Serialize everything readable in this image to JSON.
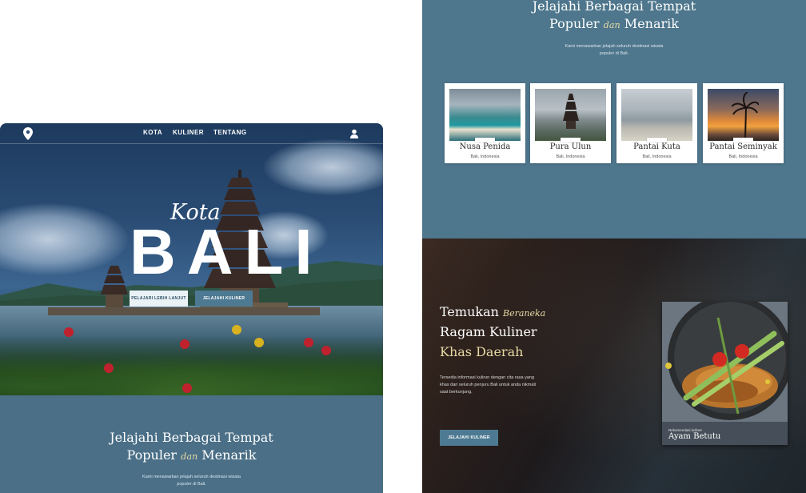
{
  "left_mock": {
    "nav": {
      "items": [
        "KOTA",
        "KULINER",
        "TENTANG"
      ],
      "logo_icon": "map-pin-icon",
      "user_icon": "user-icon"
    },
    "hero": {
      "script_word": "Kota",
      "title": "BALI",
      "primary_button": "PELAJARI LEBIH LANJUT",
      "secondary_button": "JELAJAHI KULINER"
    },
    "section": {
      "title_line1": "Jelajahi Berbagai Tempat",
      "title_line2_start": "Populer",
      "title_line2_accent": "dan",
      "title_line2_end": "Menarik",
      "subtitle_line1": "Kami menawarkan jelajah seluruh destinasi wisata",
      "subtitle_line2": "populer di Bali."
    }
  },
  "right_mock": {
    "section": {
      "title_line1": "Jelajahi Berbagai Tempat",
      "title_line2_start": "Populer",
      "title_line2_accent": "dan",
      "title_line2_end": "Menarik",
      "subtitle_line1": "Kami menawarkan jelajah seluruh destinasi wisata",
      "subtitle_line2": "populer di Bali."
    },
    "destinations": [
      {
        "name": "Nusa Penida",
        "location": "Bali, Indonesia"
      },
      {
        "name": "Pura Ulun",
        "location": "Bali, Indonesia"
      },
      {
        "name": "Pantai Kuta",
        "location": "Bali, Indonesia"
      },
      {
        "name": "Pantai Seminyak",
        "location": "Bali, Indonesia"
      }
    ],
    "culinary": {
      "title_word1": "Temukan",
      "title_accent": "Beraneka",
      "title_line2": "Ragam Kuliner",
      "title_line3": "Khas Daerah",
      "description": "Tersedia informasi kuliner dengan cita rasa yang khas dari seluruh penjuru Bali untuk anda nikmati saat berkunjung.",
      "button": "JELAJAHI KULINER",
      "card_small": "Rekomendasi kuliner",
      "card_title": "Ayam Betutu"
    }
  },
  "colors": {
    "section_bg": "#4e768c",
    "button_accent": "#4d7a92",
    "gold_accent": "#e7d9a4"
  }
}
